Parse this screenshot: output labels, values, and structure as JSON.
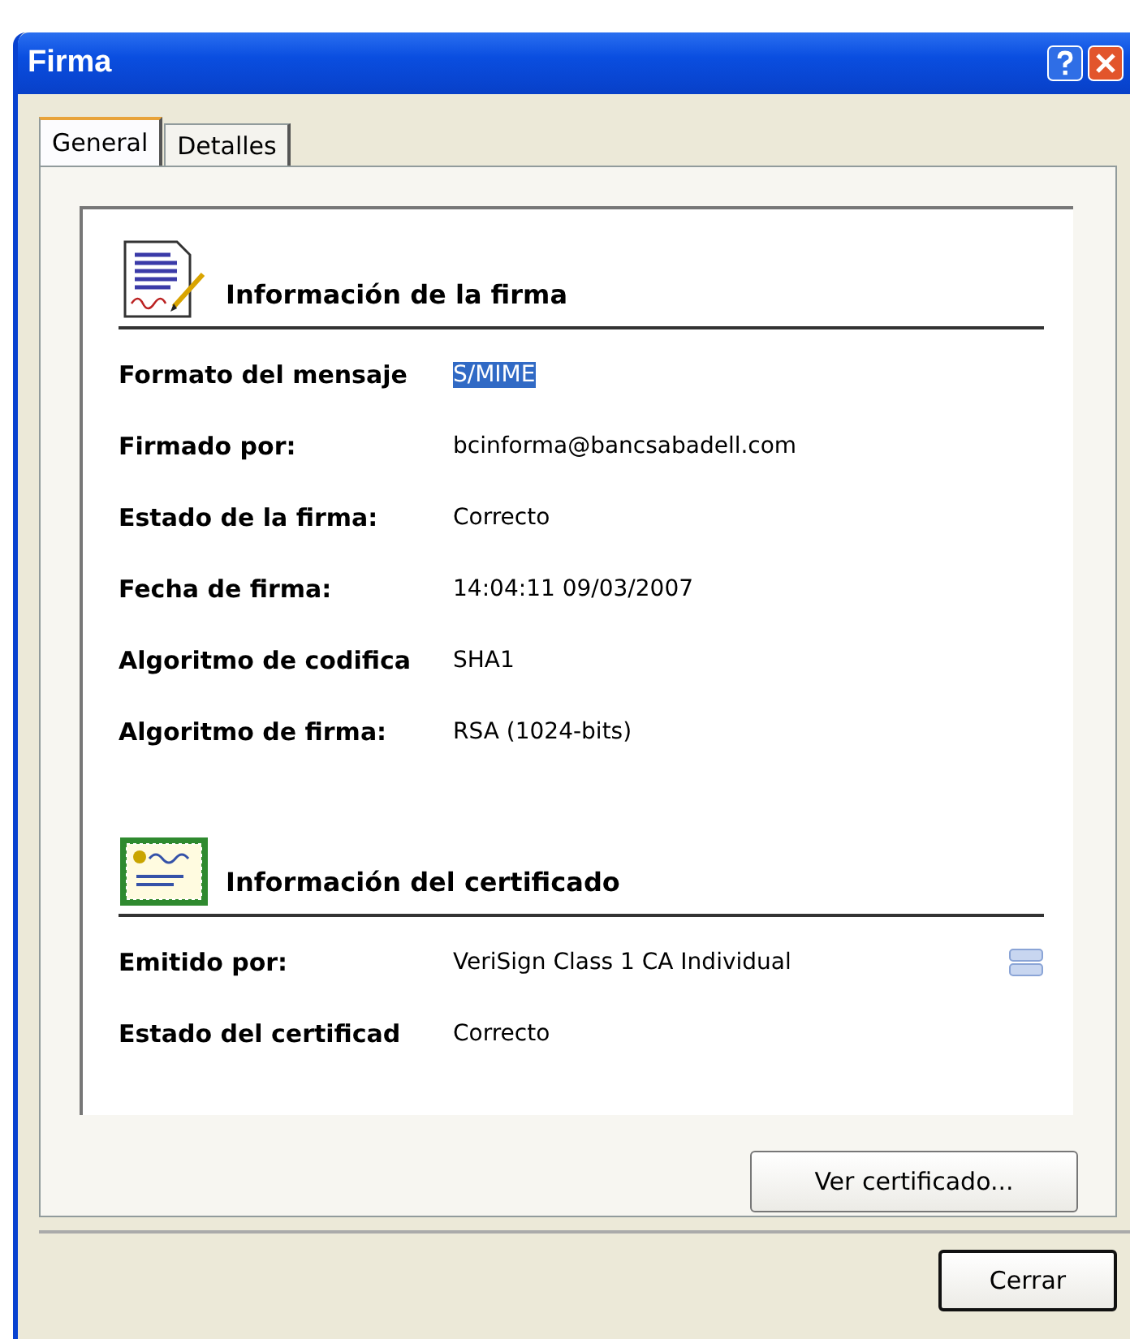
{
  "window": {
    "title": "Firma"
  },
  "tabs": [
    {
      "label": "General",
      "selected": true
    },
    {
      "label": "Detalles",
      "selected": false
    }
  ],
  "sections": [
    {
      "kind": "signature",
      "title": "Información de la firma",
      "rows": [
        {
          "label": "Formato del mensaje",
          "value": "S/MIME",
          "selected": true
        },
        {
          "label": "Firmado por:",
          "value": "bcinforma@bancsabadell.com",
          "selected": false
        },
        {
          "label": "Estado de la firma:",
          "value": "Correcto",
          "selected": false
        },
        {
          "label": "Fecha de firma:",
          "value": "14:04:11 09/03/2007",
          "selected": false
        },
        {
          "label": "Algoritmo de codifica",
          "value": "SHA1",
          "selected": false
        },
        {
          "label": "Algoritmo de firma:",
          "value": "RSA (1024-bits)",
          "selected": false
        }
      ]
    },
    {
      "kind": "certificate",
      "title": "Información del certificado",
      "rows": [
        {
          "label": "Emitido por:",
          "value": "VeriSign Class 1 CA Individual",
          "selected": false,
          "detail": true
        },
        {
          "label": "Estado del certificad",
          "value": "Correcto",
          "selected": false
        }
      ]
    }
  ],
  "view_button": "Ver certificado...",
  "close_button": "Cerrar"
}
